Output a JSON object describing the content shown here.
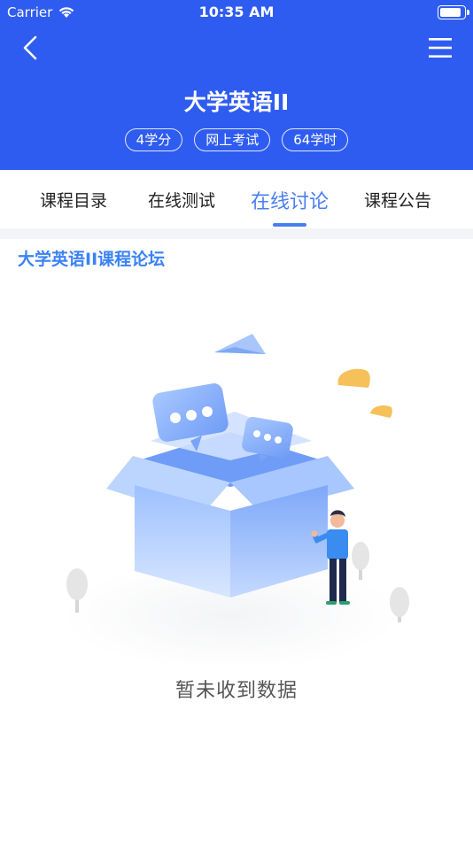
{
  "status_bar": {
    "carrier": "Carrier",
    "time": "10:35 AM",
    "battery_level_percent": 90
  },
  "nav": {
    "back_icon": "chevron-left-icon",
    "menu_icon": "hamburger-menu-icon"
  },
  "course": {
    "title": "大学英语II",
    "tags": [
      "4学分",
      "网上考试",
      "64学时"
    ]
  },
  "tabs": [
    {
      "label": "课程目录",
      "active": false
    },
    {
      "label": "在线测试",
      "active": false
    },
    {
      "label": "在线讨论",
      "active": true
    },
    {
      "label": "课程公告",
      "active": false
    }
  ],
  "forum": {
    "title": "大学英语II课程论坛"
  },
  "empty_state": {
    "message": "暂未收到数据"
  },
  "colors": {
    "header_bg": "#2f5cf0",
    "accent": "#4a7ef0",
    "forum_title": "#3b82f6",
    "box_blue": "#8ab4ff",
    "cloud_yellow": "#f6c15a"
  }
}
